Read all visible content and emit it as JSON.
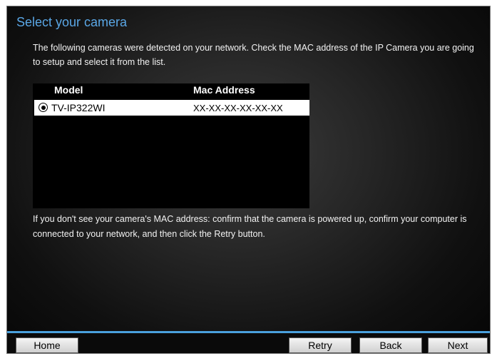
{
  "title": "Select your camera",
  "intro": "The following cameras were detected on your network. Check the MAC address of the IP Camera you are going to setup and select it from the list.",
  "table": {
    "headers": [
      "Model",
      "Mac Address"
    ],
    "rows": [
      {
        "model": "TV-IP322WI",
        "mac": "XX-XX-XX-XX-XX-XX",
        "selected": true
      }
    ]
  },
  "note": "If you don't see your camera's MAC address: confirm that the camera is powered up, confirm your computer is connected to your network, and then click the Retry button.",
  "buttons": {
    "home": "Home",
    "retry": "Retry",
    "back": "Back",
    "next": "Next"
  },
  "colors": {
    "accent": "#4aa0dd",
    "title": "#5aa7e6"
  }
}
